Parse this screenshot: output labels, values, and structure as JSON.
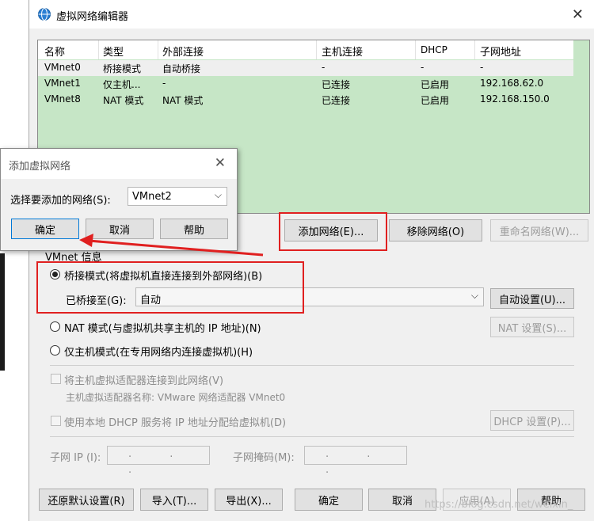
{
  "window": {
    "title": "虚拟网络编辑器",
    "close": "✕"
  },
  "table": {
    "headers": [
      "名称",
      "类型",
      "外部连接",
      "主机连接",
      "DHCP",
      "子网地址"
    ],
    "rows": [
      [
        "VMnet0",
        "桥接模式",
        "自动桥接",
        "-",
        "-",
        "-"
      ],
      [
        "VMnet1",
        "仅主机...",
        "-",
        "已连接",
        "已启用",
        "192.168.62.0"
      ],
      [
        "VMnet8",
        "NAT 模式",
        "NAT 模式",
        "已连接",
        "已启用",
        "192.168.150.0"
      ]
    ]
  },
  "net_buttons": {
    "add": "添加网络(E)...",
    "remove": "移除网络(O)",
    "rename": "重命名网络(W)..."
  },
  "vmnet_info": {
    "group_label": "VMnet 信息",
    "bridged_label": "桥接模式(将虚拟机直接连接到外部网络)(B)",
    "bridged_to_label": "已桥接至(G):",
    "bridged_to_value": "自动",
    "auto_settings": "自动设置(U)...",
    "nat_label": "NAT 模式(与虚拟机共享主机的 IP 地址)(N)",
    "nat_settings": "NAT 设置(S)...",
    "hostonly_label": "仅主机模式(在专用网络内连接虚拟机)(H)",
    "connect_adapter_label": "将主机虚拟适配器连接到此网络(V)",
    "adapter_name_label": "主机虚拟适配器名称: VMware 网络适配器 VMnet0",
    "dhcp_label": "使用本地 DHCP 服务将 IP 地址分配给虚拟机(D)",
    "dhcp_settings": "DHCP 设置(P)...",
    "subnet_ip_label": "子网 IP (I):",
    "subnet_mask_label": "子网掩码(M):",
    "ip_placeholder": ". . ."
  },
  "footer": {
    "restore": "还原默认设置(R)",
    "import": "导入(T)...",
    "export": "导出(X)...",
    "ok": "确定",
    "cancel": "取消",
    "apply": "应用(A)",
    "help": "帮助"
  },
  "dialog": {
    "title": "添加虚拟网络",
    "close": "✕",
    "select_label": "选择要添加的网络(S):",
    "select_value": "VMnet2",
    "ok": "确定",
    "cancel": "取消",
    "help": "帮助"
  },
  "watermark": "https://blog.csdn.net/weixin_",
  "colors": {
    "table_bg": "#c6e6c6",
    "highlight": "#e02020"
  }
}
